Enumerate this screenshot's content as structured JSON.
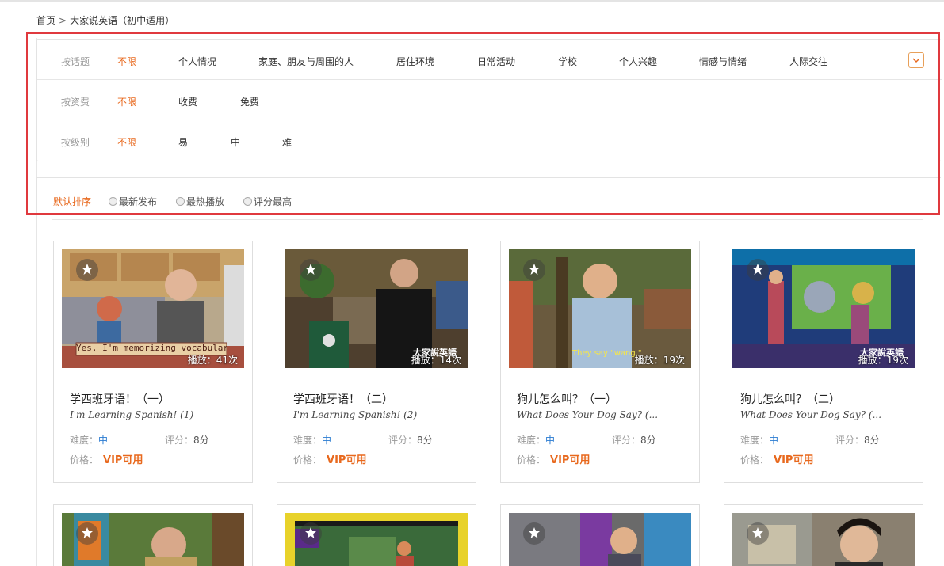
{
  "breadcrumb": {
    "home": "首页",
    "separator": ">",
    "current": "大家说英语（初中适用）"
  },
  "filters": {
    "topic": {
      "label": "按话题",
      "options": [
        "不限",
        "个人情况",
        "家庭、朋友与周围的人",
        "居住环境",
        "日常活动",
        "学校",
        "个人兴趣",
        "情感与情绪",
        "人际交往"
      ],
      "active": "不限"
    },
    "fee": {
      "label": "按资费",
      "options": [
        "不限",
        "收费",
        "免费"
      ],
      "active": "不限"
    },
    "level": {
      "label": "按级别",
      "options": [
        "不限",
        "易",
        "中",
        "难"
      ],
      "active": "不限"
    }
  },
  "sort": {
    "default": "默认排序",
    "options": [
      "最新发布",
      "最热播放",
      "评分最高"
    ]
  },
  "labels": {
    "plays": "播放：",
    "difficulty": "难度：",
    "rating": "评分：",
    "price": "价格："
  },
  "cards": [
    {
      "title": "学西班牙语！（一）",
      "subtitle": "I'm Learning Spanish! (1)",
      "plays": "41次",
      "difficulty": "中",
      "rating": "8分",
      "price": "VIP可用",
      "caption": "Yes, I'm memorizing vocabulary words."
    },
    {
      "title": "学西班牙语！（二）",
      "subtitle": "I'm Learning Spanish! (2)",
      "plays": "14次",
      "difficulty": "中",
      "rating": "8分",
      "price": "VIP可用",
      "caption": "大家說英語"
    },
    {
      "title": "狗儿怎么叫？（一）",
      "subtitle": "What Does Your Dog Say? (...",
      "plays": "19次",
      "difficulty": "中",
      "rating": "8分",
      "price": "VIP可用",
      "caption": "They say \"wang.\""
    },
    {
      "title": "狗儿怎么叫？（二）",
      "subtitle": "What Does Your Dog Say? (...",
      "plays": "19次",
      "difficulty": "中",
      "rating": "8分",
      "price": "VIP可用",
      "caption": "大家說英語"
    }
  ],
  "colors": {
    "accent": "#e8691e",
    "highlight": "#e0393e",
    "level": "#2a7bd1"
  },
  "icons": {
    "favorite": "star-icon",
    "expand": "chevron-down-icon"
  }
}
